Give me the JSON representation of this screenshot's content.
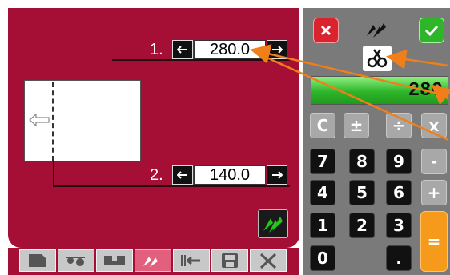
{
  "cut_rows": [
    {
      "label": "1.",
      "value": "280.0",
      "left_arrow": "←",
      "right_arrow": "→"
    },
    {
      "label": "2.",
      "value": "140.0",
      "left_arrow": "←",
      "right_arrow": "→"
    }
  ],
  "display": {
    "value": "280"
  },
  "keypad": {
    "row1": [
      "C",
      "±",
      "÷",
      "x"
    ],
    "row2": [
      "7",
      "8",
      "9",
      "-"
    ],
    "row3": [
      "4",
      "5",
      "6",
      "+"
    ],
    "row4": [
      "1",
      "2",
      "3"
    ],
    "row5": [
      "0",
      "."
    ],
    "enter": "="
  },
  "icons": {
    "cancel": "cancel-x-icon",
    "tool": "double-arrow-icon",
    "confirm": "checkmark-icon",
    "scissors": "scissors-icon"
  },
  "colors": {
    "panel": "#a50f35",
    "keypad_bg": "#7a7a7a",
    "display": "#2fb52a",
    "enter_key": "#f59a1a",
    "annotation": "#f07f1a"
  }
}
